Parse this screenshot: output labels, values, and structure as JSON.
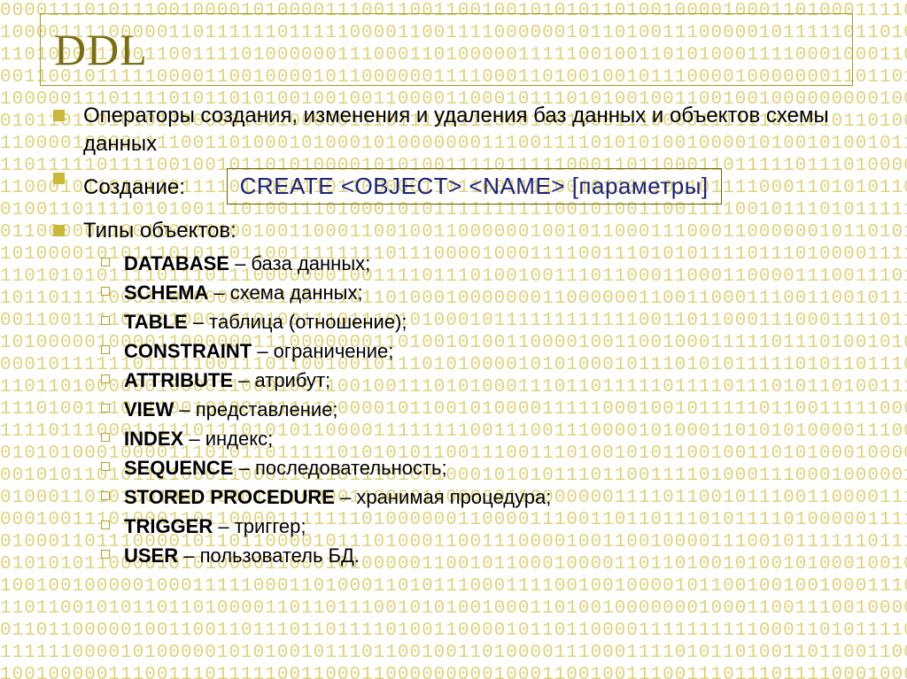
{
  "title": "DDL",
  "bullets": {
    "intro": "Операторы создания, изменения и удаления баз данных и объектов схемы данных",
    "create_label": "Создание:",
    "syntax": "CREATE <OBJECT> <NAME> [параметры]",
    "types_label": "Типы объектов:"
  },
  "object_types": [
    {
      "kw": "DATABASE",
      "desc": " – база данных;"
    },
    {
      "kw": "SCHEMA",
      "desc": " – схема данных;"
    },
    {
      "kw": "TABLE",
      "desc": " – таблица (отношение);"
    },
    {
      "kw": "CONSTRAINT",
      "desc": " – ограничение;"
    },
    {
      "kw": "ATTRIBUTE",
      "desc": " – атрибут;"
    },
    {
      "kw": "VIEW",
      "desc": " – представление;"
    },
    {
      "kw": "INDEX",
      "desc": " – индекс;"
    },
    {
      "kw": "SEQUENCE",
      "desc": " – последовательность;"
    },
    {
      "kw": "STORED PROCEDURE",
      "desc": " – хранимая процедура;"
    },
    {
      "kw": "TRIGGER",
      "desc": " – триггер;"
    },
    {
      "kw": "USER",
      "desc": " – пользователь БД."
    }
  ],
  "bg_rows": 31,
  "bg_cols": 78
}
